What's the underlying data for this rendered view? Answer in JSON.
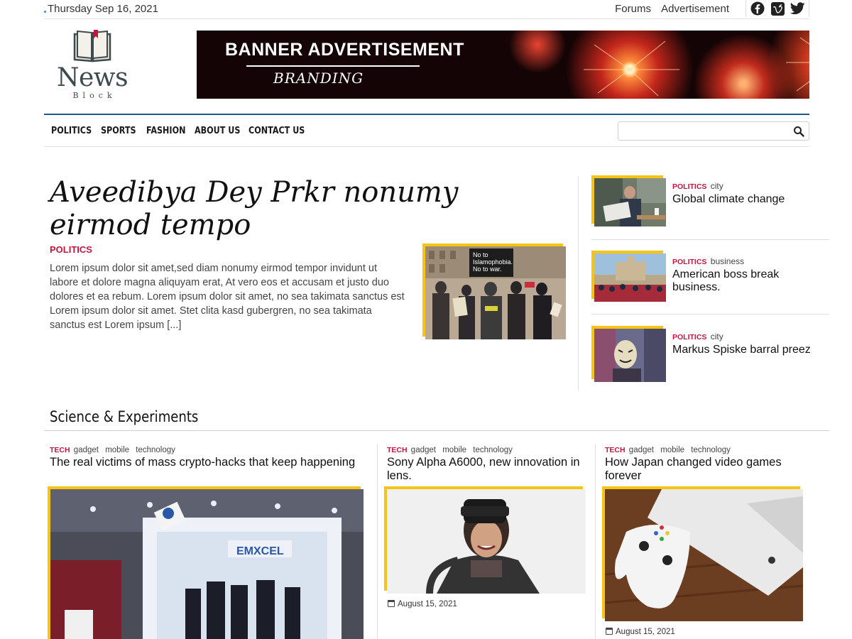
{
  "topbar": {
    "date": "Thursday Sep 16, 2021",
    "links": [
      "Forums",
      "Advertisement"
    ],
    "social_icons": [
      "facebook-icon",
      "vimeo-icon",
      "twitter-icon"
    ]
  },
  "logo": {
    "word": "News",
    "sub": "Block"
  },
  "banner": {
    "line1": "BANNER ADVERTISEMENT",
    "line2": "BRANDING"
  },
  "nav": {
    "items": [
      "POLITICS",
      "SPORTS",
      "FASHION",
      "ABOUT US",
      "CONTACT US"
    ],
    "search_placeholder": ""
  },
  "hero": {
    "title": "Aveedibya Dey Prkr nonumy eirmod tempo",
    "category": "POLITICS",
    "excerpt": "Lorem ipsum dolor sit amet,sed diam nonumy eirmod tempor invidunt ut labore et dolore magna aliquyam erat, At vero eos et accusam et justo duo dolores et ea rebum. Lorem ipsum dolor sit amet, no sea takimata sanctus est Lorem ipsum dolor sit amet. Stet clita kasd gubergren, no sea takimata sanctus est Lorem ipsum [...]",
    "image_sign": "No to Islamophobia. No to war."
  },
  "sidebar": [
    {
      "category": "POLITICS",
      "tag": "city",
      "title": "Global climate change"
    },
    {
      "category": "POLITICS",
      "tag": "business",
      "title": "American boss break business."
    },
    {
      "category": "POLITICS",
      "tag": "city",
      "title": "Markus Spiske barral preez"
    }
  ],
  "section": {
    "title": "Science & Experiments",
    "cards": [
      {
        "category": "TECH",
        "tags": [
          "gadget",
          "mobile",
          "technology"
        ],
        "title": "The real victims of mass crypto-hacks that keep happening",
        "date": "",
        "image_text": "EMXCEL"
      },
      {
        "category": "TECH",
        "tags": [
          "gadget",
          "mobile",
          "technology"
        ],
        "title": "Sony Alpha A6000, new innovation in lens.",
        "date": "August 15, 2021"
      },
      {
        "category": "TECH",
        "tags": [
          "gadget",
          "mobile",
          "technology"
        ],
        "title": "How Japan changed video games forever",
        "date": "August 15, 2021"
      }
    ]
  },
  "colors": {
    "accent_red": "#c3163f",
    "frame_yellow": "#f5c414",
    "nav_rule": "#1b5b8a"
  }
}
